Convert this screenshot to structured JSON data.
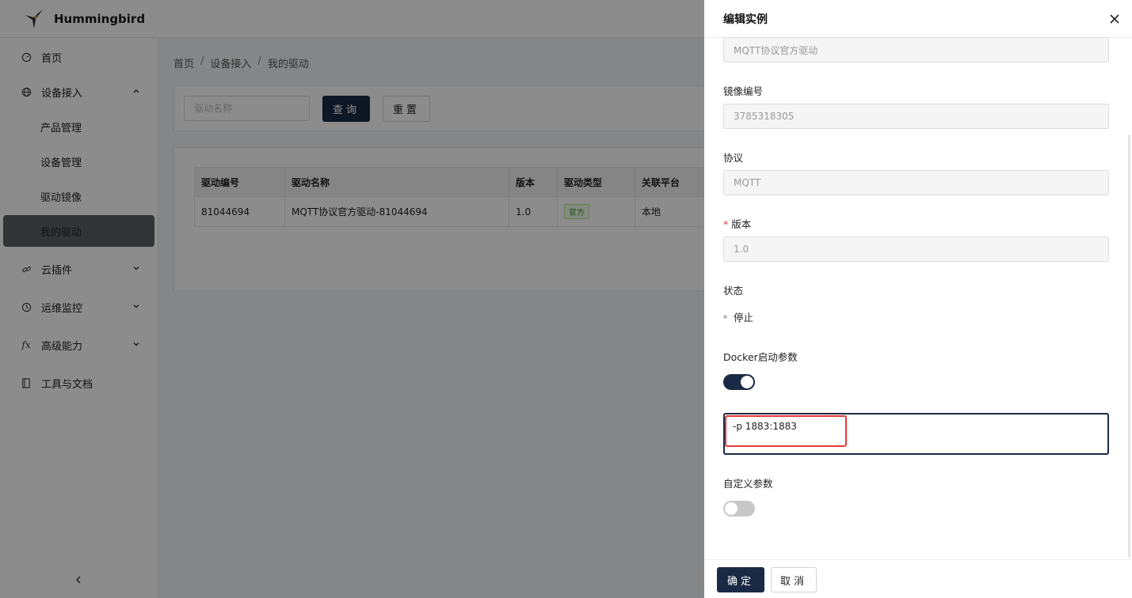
{
  "app": {
    "title": "Hummingbird"
  },
  "sidebar": {
    "items": [
      {
        "label": "首页",
        "icon": "dashboard-icon"
      },
      {
        "label": "设备接入",
        "icon": "globe-icon",
        "expanded": true
      },
      {
        "label": "云插件",
        "icon": "link-icon"
      },
      {
        "label": "运维监控",
        "icon": "clock-icon"
      },
      {
        "label": "高级能力",
        "icon": "function-icon"
      },
      {
        "label": "工具与文档",
        "icon": "document-icon"
      }
    ],
    "sub_items": [
      {
        "label": "产品管理"
      },
      {
        "label": "设备管理"
      },
      {
        "label": "驱动镜像"
      },
      {
        "label": "我的驱动",
        "active": true
      }
    ]
  },
  "breadcrumb": [
    "首页",
    "设备接入",
    "我的驱动"
  ],
  "filter": {
    "placeholder": "驱动名称",
    "query_label": "查询",
    "reset_label": "重置"
  },
  "table": {
    "columns": [
      "驱动编号",
      "驱动名称",
      "版本",
      "驱动类型",
      "关联平台"
    ],
    "rows": [
      {
        "id": "81044694",
        "name": "MQTT协议官方驱动-81044694",
        "version": "1.0",
        "type": "官方",
        "platform": "本地"
      }
    ]
  },
  "drawer": {
    "title": "编辑实例",
    "name_value": "MQTT协议官方驱动",
    "image_label": "镜像编号",
    "image_value": "3785318305",
    "protocol_label": "协议",
    "protocol_value": "MQTT",
    "version_label": "版本",
    "version_value": "1.0",
    "status_label": "状态",
    "status_value": "停止",
    "docker_label": "Docker启动参数",
    "docker_enabled": true,
    "docker_value": "-p 1883:1883",
    "custom_label": "自定义参数",
    "custom_enabled": false,
    "ok_label": "确定",
    "cancel_label": "取消"
  },
  "colors": {
    "primary": "#1b2a44",
    "highlight": "#e53935",
    "tag_green": "#3a9a2a"
  }
}
